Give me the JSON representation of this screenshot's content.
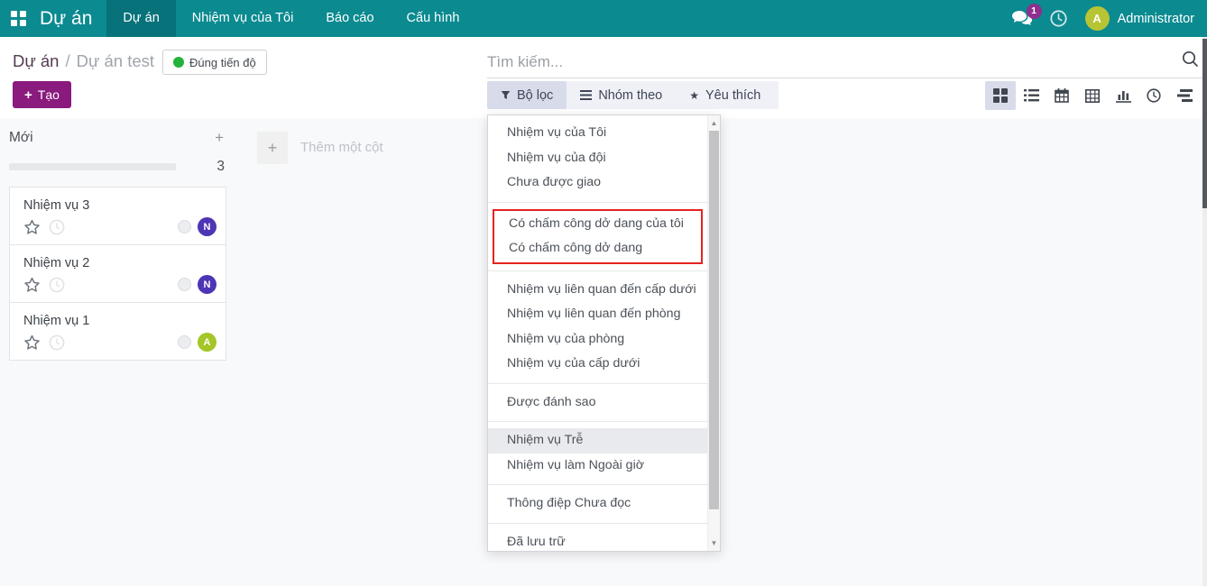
{
  "nav": {
    "brand": "Dự án",
    "items": [
      {
        "label": "Dự án",
        "active": true
      },
      {
        "label": "Nhiệm vụ của Tôi"
      },
      {
        "label": "Báo cáo"
      },
      {
        "label": "Cấu hình"
      }
    ],
    "messages_badge": "1",
    "user_name": "Administrator",
    "user_initial": "A",
    "bar_color": "#0b8a90",
    "active_item_color": "#077279"
  },
  "breadcrumb": {
    "root": "Dự án",
    "separator": "/",
    "current": "Dự án test"
  },
  "status_badge": {
    "label": "Đúng tiến độ",
    "dot_color": "#23b33a"
  },
  "create_button": {
    "label": "Tạo",
    "plus": "+",
    "color": "#8a1a7d"
  },
  "search": {
    "placeholder": "Tìm kiếm..."
  },
  "control_panel": {
    "filters_label": "Bộ lọc",
    "group_by_label": "Nhóm theo",
    "favorites_label": "Yêu thích",
    "active_button": "Bộ lọc"
  },
  "view_switcher": {
    "views": [
      "kanban",
      "list",
      "calendar",
      "pivot",
      "graph",
      "activity",
      "gantt"
    ],
    "active": "kanban"
  },
  "kanban": {
    "column": {
      "title": "Mới",
      "count": "3",
      "add_record": "+"
    },
    "cards": [
      {
        "title": "Nhiệm vụ 3",
        "avatar_initial": "N",
        "avatar_color": "#4e35b5"
      },
      {
        "title": "Nhiệm vụ 2",
        "avatar_initial": "N",
        "avatar_color": "#4e35b5"
      },
      {
        "title": "Nhiệm vụ 1",
        "avatar_initial": "A",
        "avatar_color": "#a4c627"
      }
    ],
    "add_column_plus": "+",
    "add_column_label": "Thêm một cột"
  },
  "filter_menu": {
    "highlight_color": "#e3241d",
    "groups": [
      {
        "items": [
          {
            "label": "Nhiệm vụ của Tôi"
          },
          {
            "label": "Nhiệm vụ của đội"
          },
          {
            "label": "Chưa được giao"
          }
        ]
      },
      {
        "highlighted": true,
        "items": [
          {
            "label": "Có chấm công dở dang của tôi"
          },
          {
            "label": "Có chấm công dở dang"
          }
        ]
      },
      {
        "items": [
          {
            "label": "Nhiệm vụ liên quan đến cấp dưới"
          },
          {
            "label": "Nhiệm vụ liên quan đến phòng"
          },
          {
            "label": "Nhiệm vụ của phòng"
          },
          {
            "label": "Nhiệm vụ của cấp dưới"
          }
        ]
      },
      {
        "items": [
          {
            "label": "Được đánh sao"
          }
        ]
      },
      {
        "items": [
          {
            "label": "Nhiệm vụ Trễ",
            "hovered": true
          },
          {
            "label": "Nhiệm vụ làm Ngoài giờ"
          }
        ]
      },
      {
        "items": [
          {
            "label": "Thông điệp Chưa đọc"
          }
        ]
      },
      {
        "items": [
          {
            "label": "Đã lưu trữ"
          }
        ]
      }
    ]
  }
}
